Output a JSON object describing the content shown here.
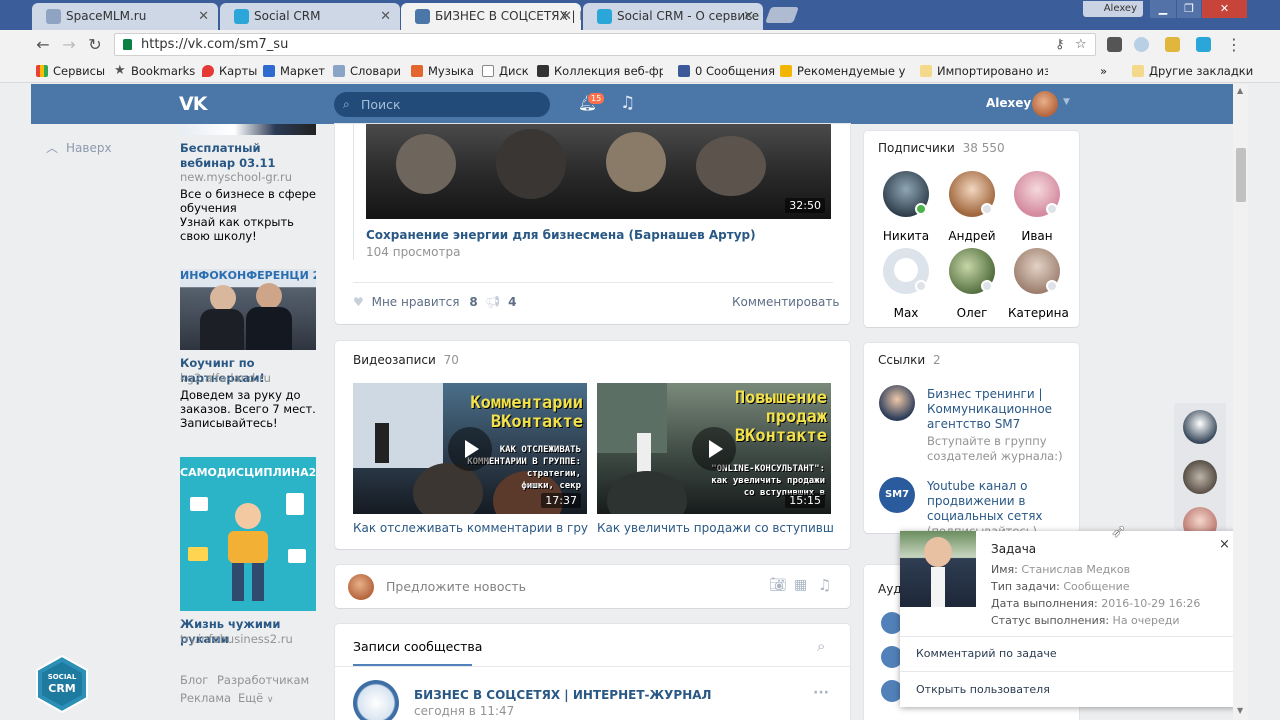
{
  "browser": {
    "tabs": [
      {
        "label": "SpaceMLM.ru",
        "active": false
      },
      {
        "label": "Social CRM",
        "active": false
      },
      {
        "label": "БИЗНЕС В СОЦСЕТЯХ | И",
        "active": true
      },
      {
        "label": "Social CRM - О сервисе",
        "active": false
      }
    ],
    "profile_name": "Alexey",
    "url": "https://vk.com/sm7_su",
    "bookmarks": [
      "Сервисы",
      "Bookmarks",
      "Карты",
      "Маркет",
      "Словари",
      "Музыка",
      "Диск",
      "Коллекция веб-фраг",
      "0 Сообщения",
      "Рекомендуемые узлы",
      "Импортировано из I"
    ],
    "bookmarks_more": "»",
    "other_bookmarks": "Другие закладки"
  },
  "vk": {
    "search_placeholder": "Поиск",
    "notif_count": "15",
    "user_name": "Alexey"
  },
  "left": {
    "back_top": "Наверх",
    "ads": [
      {
        "title": "Бесплатный вебинар 03.11",
        "domain": "new.myschool-gr.ru",
        "text": "Все о бизнесе в сфере обучения\nУзнай как открыть свою школу!"
      },
      {
        "image_text": "ИНФОКОНФЕРЕНЦИ 201",
        "title": "Коучинг по партнеркам!",
        "domain": "kg2.alfa-land.ru",
        "text": "Доведем за руку до заказов. Всего 7 мест. Записывайтесь!"
      },
      {
        "image_text": "САМОДИСЦИПЛИНА2",
        "title": "Жизнь чужими руками",
        "domain": "try.infobusiness2.ru",
        "text": ""
      }
    ],
    "footer": [
      "Блог",
      "Разработчикам",
      "Реклама",
      "Ещё"
    ]
  },
  "post_video": {
    "duration": "32:50",
    "title": "Сохранение энергии для бизнесмена (Барнашев Артур)",
    "views": "104 просмотра",
    "likes_label": "Мне нравится",
    "likes_count": "8",
    "shares_count": "4",
    "comment_label": "Комментировать"
  },
  "videos": {
    "header": "Видеозаписи",
    "count": "70",
    "items": [
      {
        "overlay": "Комментарии\nВКонтакте",
        "overlay_sub": "КАК ОТСЛЕЖИВАТЬ\nКОММЕНТАРИИ В ГРУППЕ:\nстратегии,\nфишки, секр",
        "duration": "17:37",
        "caption": "Как отслеживать комментарии в группе ..."
      },
      {
        "overlay": "Повышение\nпродаж\nВКонтакте",
        "overlay_sub": "\"ONLINE-КОНСУЛЬТАНТ\":\nкак увеличить продажи\nсо вступивших в",
        "duration": "15:15",
        "caption": "Как увеличить продажи со вступивших в..."
      }
    ]
  },
  "suggest": {
    "placeholder": "Предложите новость"
  },
  "wall": {
    "tab": "Записи сообщества",
    "post_author": "БИЗНЕС В СОЦСЕТЯХ | ИНТЕРНЕТ-ЖУРНАЛ",
    "post_time": "сегодня в 11:47",
    "more": "···"
  },
  "subscribers": {
    "header": "Подписчики",
    "count": "38 550",
    "people": [
      "Никита",
      "Андрей",
      "Иван",
      "Max",
      "Олег",
      "Катерина"
    ]
  },
  "links": {
    "header": "Ссылки",
    "count": "2",
    "items": [
      {
        "icon_text": "",
        "title": "Бизнес тренинги | Коммуникационное агентство SM7",
        "desc": "Вступайте в группу создателей журнала:)"
      },
      {
        "icon_text": "SM7",
        "title": "Youtube канал о продвижении в социальных сетях",
        "desc": "(подписывайтесь)"
      }
    ]
  },
  "audio_header_partial": "Ауд",
  "popup": {
    "title": "Задача",
    "close": "×",
    "fields": [
      {
        "label": "Имя:",
        "value": "Станислав Медков"
      },
      {
        "label": "Тип задачи:",
        "value": "Сообщение"
      },
      {
        "label": "Дата выполнения:",
        "value": "2016-10-29 16:26"
      },
      {
        "label": "Статус выполнения:",
        "value": "На очереди"
      }
    ],
    "actions": [
      "Комментарий по задаче",
      "Открыть пользователя"
    ]
  },
  "crm_badge": {
    "line1": "SOCIAL",
    "line2": "CRM"
  },
  "colors": {
    "vk_blue": "#4a76a8",
    "link": "#2a5885",
    "muted": "#939393",
    "bg": "#edeef0"
  }
}
